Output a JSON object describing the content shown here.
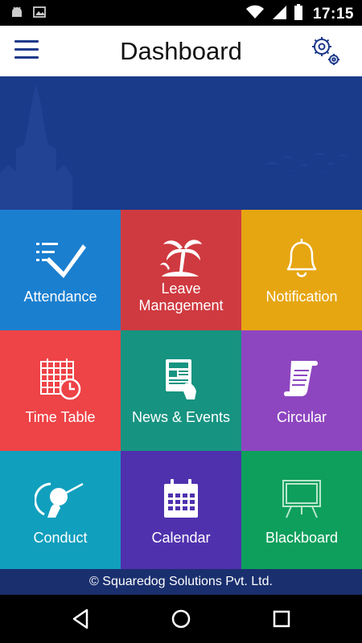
{
  "status_bar": {
    "time": "17:15",
    "icons": [
      "android-icon",
      "image-icon",
      "wifi-icon",
      "signal-icon",
      "battery-icon"
    ]
  },
  "app_bar": {
    "title": "Dashboard",
    "menu_icon": "hamburger-menu-icon",
    "settings_icon": "gear-icon"
  },
  "colors": {
    "attendance": "#1b7fcf",
    "leave": "#cf3a40",
    "notification": "#e6a612",
    "timetable": "#ee4347",
    "news": "#169381",
    "circular": "#8e46c0",
    "conduct": "#109fbd",
    "calendar": "#4f31ae",
    "blackboard": "#0e9f5c",
    "banner": "#1a3a8a",
    "footer": "#1a2f6e"
  },
  "tiles": [
    {
      "label": "Attendance",
      "icon": "checklist-icon"
    },
    {
      "label": "Leave Management",
      "label_line1": "Leave",
      "label_line2": "Management",
      "icon": "palm-tree-icon"
    },
    {
      "label": "Notification",
      "icon": "bell-icon"
    },
    {
      "label": "Time Table",
      "icon": "timetable-clock-icon"
    },
    {
      "label": "News & Events",
      "icon": "newspaper-icon"
    },
    {
      "label": "Circular",
      "icon": "scroll-icon"
    },
    {
      "label": "Conduct",
      "icon": "conductor-baton-icon"
    },
    {
      "label": "Calendar",
      "icon": "calendar-icon"
    },
    {
      "label": "Blackboard",
      "icon": "blackboard-icon"
    }
  ],
  "footer": {
    "text": "© Squaredog Solutions Pvt. Ltd."
  },
  "nav_bar": {
    "buttons": [
      "back-icon",
      "home-icon",
      "recents-icon"
    ]
  }
}
